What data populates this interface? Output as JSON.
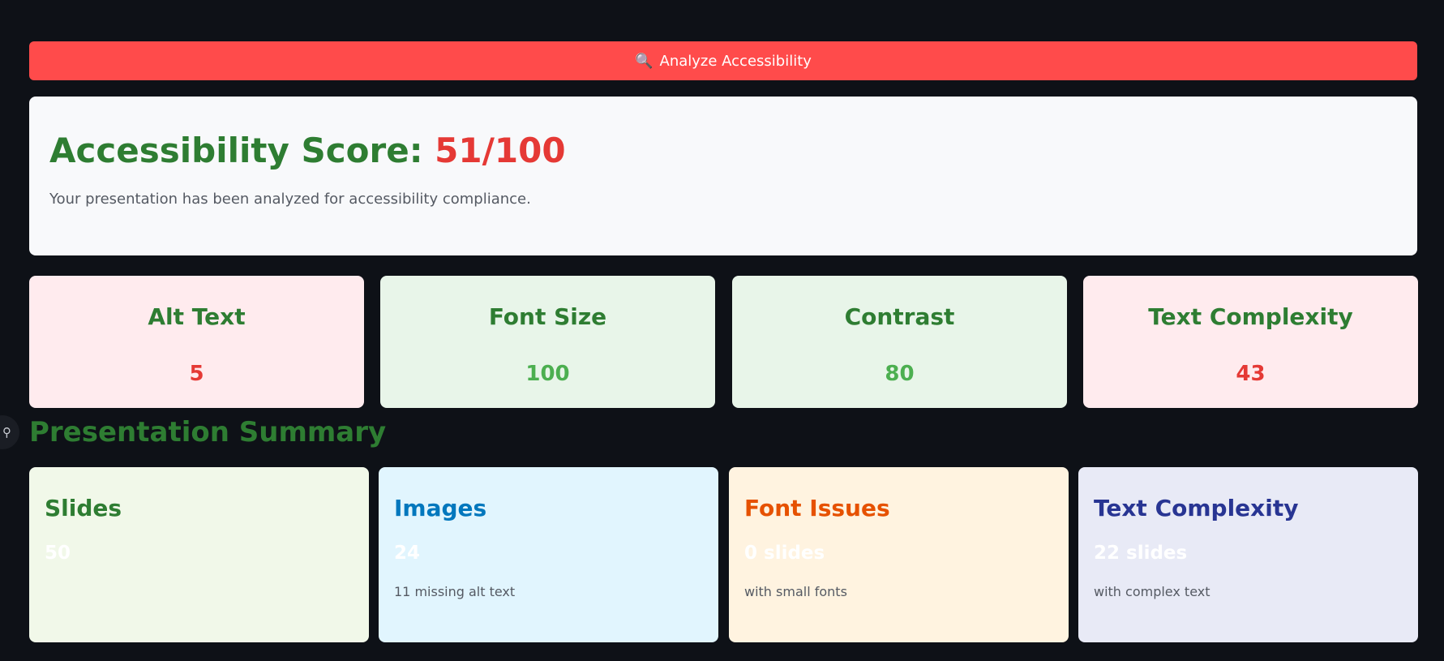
{
  "analyze_button": {
    "icon": "magnifier-icon",
    "icon_glyph": "🔍",
    "label": "Analyze Accessibility",
    "color": "#ff4b4b"
  },
  "score": {
    "label": "Accessibility Score:",
    "value": "51/100",
    "description": "Your presentation has been analyzed for accessibility compliance."
  },
  "metrics": [
    {
      "label": "Alt Text",
      "value": "5",
      "status": "bad"
    },
    {
      "label": "Font Size",
      "value": "100",
      "status": "good"
    },
    {
      "label": "Contrast",
      "value": "80",
      "status": "good"
    },
    {
      "label": "Text Complexity",
      "value": "43",
      "status": "bad"
    }
  ],
  "side_tool": {
    "icon": "pin-icon",
    "glyph": "⚲"
  },
  "summary": {
    "title": "Presentation Summary",
    "cards": [
      {
        "title": "Slides",
        "value": "50",
        "note": ""
      },
      {
        "title": "Images",
        "value": "24",
        "note": "11 missing alt text"
      },
      {
        "title": "Font Issues",
        "value": "0 slides",
        "note": "with small fonts"
      },
      {
        "title": "Text Complexity",
        "value": "22 slides",
        "note": "with complex text"
      }
    ]
  },
  "colors": {
    "background": "#0e1117",
    "good": "#4caf50",
    "bad": "#e53935",
    "heading": "#2e7d32"
  }
}
